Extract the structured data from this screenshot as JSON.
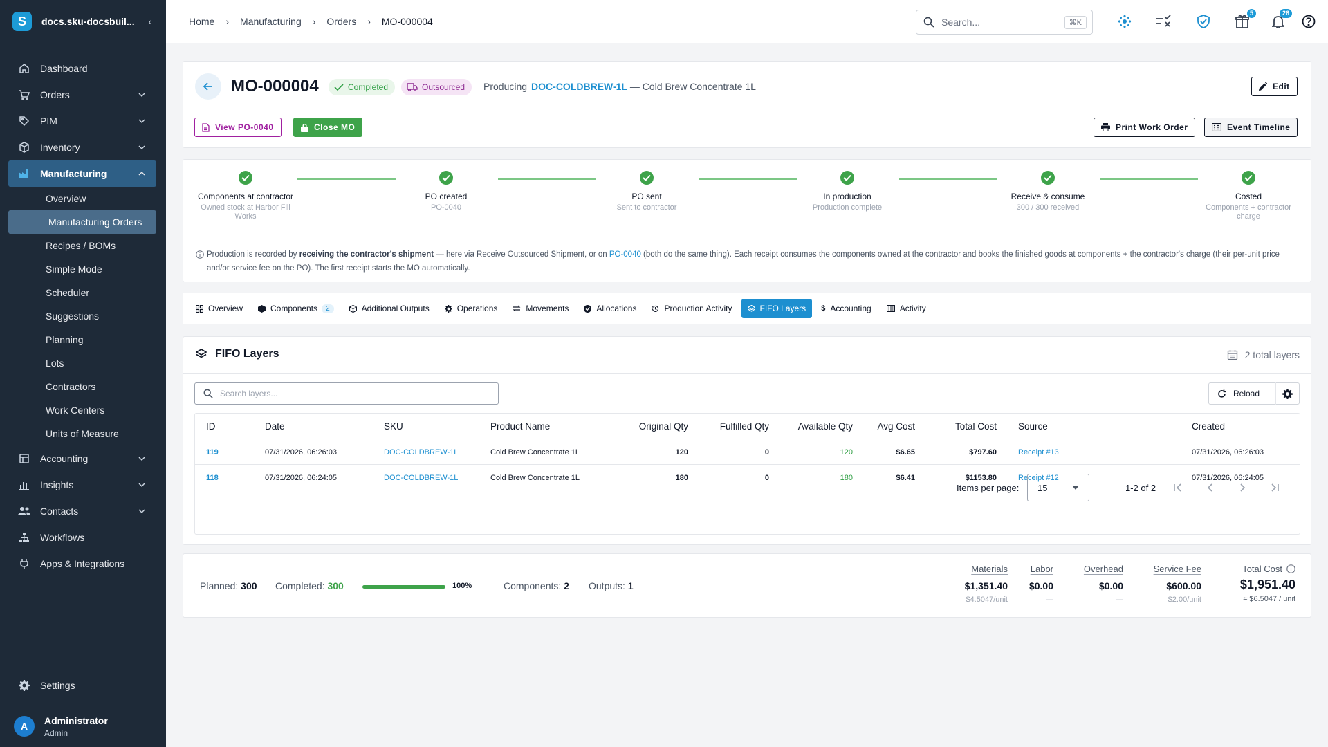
{
  "app": {
    "title": "docs.sku-docsbuil...",
    "logo_letter": "S",
    "collapse_glyph": "‹"
  },
  "sidebar": {
    "items": [
      {
        "label": "Dashboard",
        "icon": "home-icon"
      },
      {
        "label": "Orders",
        "icon": "cart-icon"
      },
      {
        "label": "PIM",
        "icon": "tag-icon"
      },
      {
        "label": "Inventory",
        "icon": "box-icon"
      },
      {
        "label": "Manufacturing",
        "icon": "factory-icon"
      }
    ],
    "manufacturing_sub": [
      "Overview",
      "Manufacturing Orders",
      "Recipes / BOMs",
      "Simple Mode",
      "Scheduler",
      "Suggestions",
      "Planning",
      "Lots",
      "Contractors",
      "Work Centers",
      "Units of Measure"
    ],
    "items_after": [
      {
        "label": "Accounting",
        "icon": "accounting-icon"
      },
      {
        "label": "Insights",
        "icon": "chart-icon"
      },
      {
        "label": "Contacts",
        "icon": "contacts-icon"
      },
      {
        "label": "Workflows",
        "icon": "workflow-icon"
      },
      {
        "label": "Apps & Integrations",
        "icon": "apps-icon"
      }
    ],
    "settings_label": "Settings",
    "user": {
      "initial": "A",
      "name": "Administrator",
      "role": "Admin"
    }
  },
  "topbar": {
    "breadcrumb": [
      "Home",
      "Manufacturing",
      "Orders",
      "MO-000004"
    ],
    "separator": "›",
    "search_placeholder": "Search...",
    "search_shortcut": "⌘K",
    "gift_badge": "5",
    "notif_badge": "26"
  },
  "header": {
    "title": "MO-000004",
    "status_completed": "Completed",
    "status_outsourced": "Outsourced",
    "producing_label": "Producing",
    "sku": "DOC-COLDBREW-1L",
    "product_name": " — Cold Brew Concentrate 1L",
    "edit_label": "Edit",
    "view_po_label": "View PO-0040",
    "close_mo_label": "Close MO",
    "print_label": "Print Work Order",
    "timeline_label": "Event Timeline"
  },
  "stepper": {
    "steps": [
      {
        "title": "Components at contractor",
        "sub": "Owned stock at Harbor Fill Works"
      },
      {
        "title": "PO created",
        "sub": "PO-0040"
      },
      {
        "title": "PO sent",
        "sub": "Sent to contractor"
      },
      {
        "title": "In production",
        "sub": "Production complete"
      },
      {
        "title": "Receive & consume",
        "sub": "300 / 300 received"
      },
      {
        "title": "Costed",
        "sub": "Components + contractor charge"
      }
    ],
    "note_pre": "Production is recorded by ",
    "note_bold": "receiving the contractor's shipment",
    "note_mid": " — here via Receive Outsourced Shipment, or on ",
    "note_link": "PO-0040",
    "note_post": " (both do the same thing). Each receipt consumes the components owned at the contractor and books the finished goods at components + the contractor's charge (their per-unit price and/or service fee on the PO). The first receipt starts the MO automatically."
  },
  "tabs": [
    {
      "label": "Overview",
      "icon": "grid-icon"
    },
    {
      "label": "Components",
      "icon": "cube-icon",
      "count": "2"
    },
    {
      "label": "Additional Outputs",
      "icon": "cube-plus-icon"
    },
    {
      "label": "Operations",
      "icon": "gear-icon"
    },
    {
      "label": "Movements",
      "icon": "swap-icon"
    },
    {
      "label": "Allocations",
      "icon": "check-circle-icon"
    },
    {
      "label": "Production Activity",
      "icon": "history-icon"
    },
    {
      "label": "FIFO Layers",
      "icon": "layers-icon"
    },
    {
      "label": "Accounting",
      "icon": "dollar-icon"
    },
    {
      "label": "Activity",
      "icon": "list-icon"
    }
  ],
  "fifo": {
    "title": "FIFO Layers",
    "total_layers": "2 total layers",
    "search_placeholder": "Search layers...",
    "reload_label": "Reload",
    "columns": [
      "ID",
      "Date",
      "SKU",
      "Product Name",
      "Original Qty",
      "Fulfilled Qty",
      "Available Qty",
      "Avg Cost",
      "Total Cost",
      "Source",
      "Created"
    ],
    "rows": [
      {
        "id": "119",
        "date": "07/31/2026, 06:26:03",
        "sku": "DOC-COLDBREW-1L",
        "product": "Cold Brew Concentrate 1L",
        "original": "120",
        "fulfilled": "0",
        "available": "120",
        "avg_cost": "$6.65",
        "total_cost": "$797.60",
        "source": "Receipt #13",
        "created": "07/31/2026, 06:26:03"
      },
      {
        "id": "118",
        "date": "07/31/2026, 06:24:05",
        "sku": "DOC-COLDBREW-1L",
        "product": "Cold Brew Concentrate 1L",
        "original": "180",
        "fulfilled": "0",
        "available": "180",
        "avg_cost": "$6.41",
        "total_cost": "$1153.80",
        "source": "Receipt #12",
        "created": "07/31/2026, 06:24:05"
      }
    ],
    "items_per_page_label": "Items per page:",
    "items_per_page": "15",
    "range": "1-2 of 2"
  },
  "summary": {
    "planned_label": "Planned:",
    "planned": "300",
    "completed_label": "Completed:",
    "completed": "300",
    "progress_fraction": 1.0,
    "progress_pct": "100%",
    "components_label": "Components:",
    "components": "2",
    "outputs_label": "Outputs:",
    "outputs": "1",
    "costs": [
      {
        "label": "Materials",
        "value": "$1,351.40",
        "unit": "$4.5047/unit"
      },
      {
        "label": "Labor",
        "value": "$0.00",
        "unit": "—"
      },
      {
        "label": "Overhead",
        "value": "$0.00",
        "unit": "—"
      },
      {
        "label": "Service Fee",
        "value": "$600.00",
        "unit": "$2.00/unit"
      }
    ],
    "total_label": "Total Cost",
    "total_value": "$1,951.40",
    "total_unit": "≈ $6.5047 / unit"
  },
  "colors": {
    "primary": "#1d8fd0",
    "success": "#3ea34a",
    "sidebar": "#1e2a38",
    "outsourced": "#8e2b93"
  }
}
